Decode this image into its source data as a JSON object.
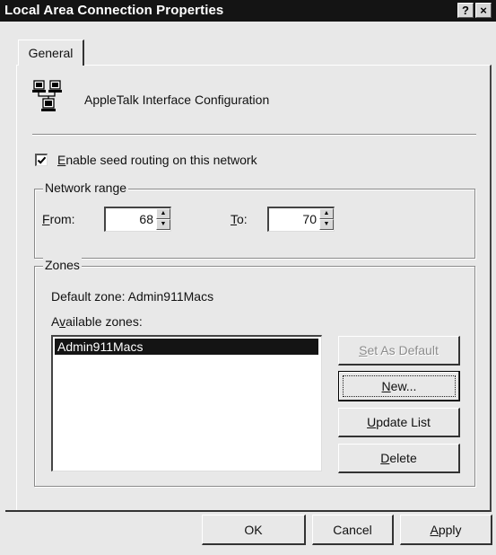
{
  "window": {
    "title": "Local Area Connection Properties",
    "help_button": "?",
    "close_button": "×"
  },
  "tabs": [
    {
      "label": "General",
      "selected": true
    }
  ],
  "header": {
    "icon": "network-computers-icon",
    "label": "AppleTalk Interface Configuration"
  },
  "seed_routing": {
    "checked": true,
    "label_accel": "E",
    "label_rest": "nable seed routing on this network"
  },
  "network_range": {
    "title": "Network range",
    "from_accel": "F",
    "from_rest": "rom:",
    "from_value": "68",
    "to_accel": "T",
    "to_rest": "o:",
    "to_value": "70"
  },
  "zones": {
    "title": "Zones",
    "default_zone_text": "Default zone:  Admin911Macs",
    "available_pre": "A",
    "available_accel": "v",
    "available_rest": "ailable zones:",
    "items": [
      {
        "label": "Admin911Macs",
        "selected": true
      }
    ],
    "buttons": {
      "set_default_accel": "S",
      "set_default_rest": "et As Default",
      "set_default_enabled": false,
      "new_accel": "N",
      "new_rest": "ew...",
      "update_accel": "U",
      "update_rest": "pdate List",
      "delete_accel": "D",
      "delete_rest": "elete"
    }
  },
  "footer": {
    "ok": "OK",
    "cancel": "Cancel",
    "apply_accel": "A",
    "apply_rest": "pply"
  }
}
